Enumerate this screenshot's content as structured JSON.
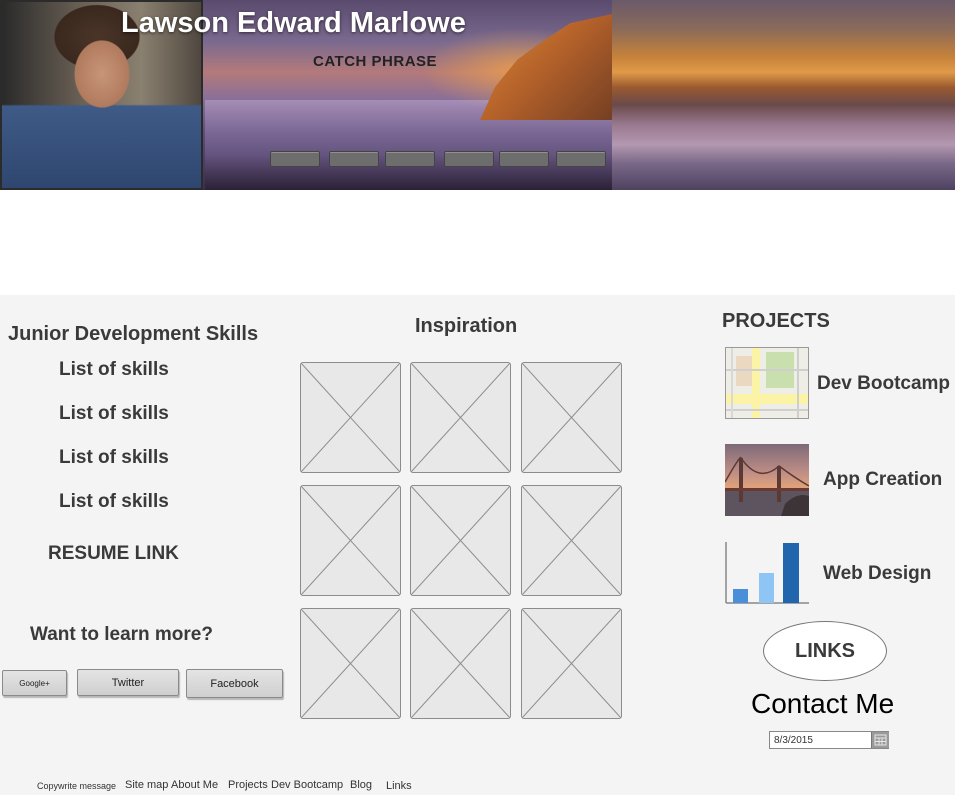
{
  "header": {
    "name": "Lawson Edward Marlowe",
    "catch_phrase": "CATCH PHRASE",
    "nav_buttons": [
      "",
      "",
      "",
      "",
      "",
      ""
    ]
  },
  "skills": {
    "title": "Junior Development Skills",
    "items": [
      "List of skills",
      "List of skills",
      "List of skills",
      "List of skills"
    ],
    "resume_link": "RESUME LINK",
    "learn_more": "Want to learn more?",
    "social": [
      "Google+",
      "Twitter",
      "Facebook"
    ]
  },
  "inspiration": {
    "title": "Inspiration"
  },
  "projects": {
    "title": "PROJECTS",
    "items": [
      {
        "label": "Dev Bootcamp",
        "icon": "map-icon"
      },
      {
        "label": "App Creation",
        "icon": "bridge-photo"
      },
      {
        "label": "Web Design",
        "icon": "bar-chart-icon"
      }
    ],
    "links_label": "LINKS",
    "contact_label": "Contact Me",
    "date_value": "8/3/2015"
  },
  "footer": {
    "copyright": "Copywrite message",
    "links": [
      "Site map",
      "About Me",
      "Projects",
      "Dev Bootcamp",
      "Blog",
      "Links"
    ]
  },
  "colors": {
    "section_bg": "#f4f4f4",
    "text_dark": "#3a3a3a",
    "chart_bar_1": "#4a90d9",
    "chart_bar_2": "#8ec5f5",
    "chart_bar_3": "#2166ac"
  }
}
